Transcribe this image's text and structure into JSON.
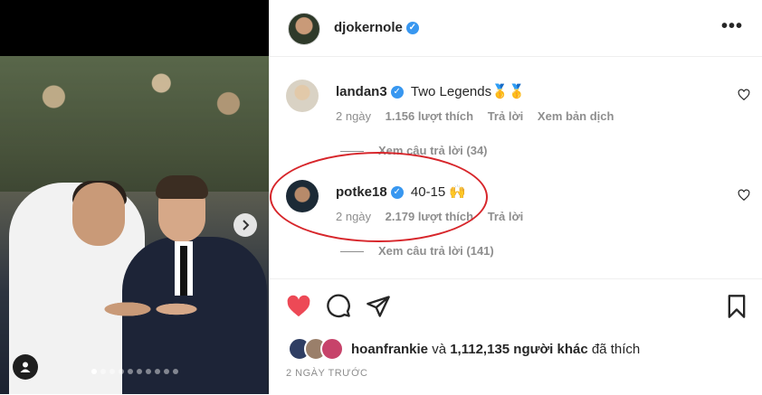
{
  "post": {
    "username": "djokernole",
    "more_label": "•••"
  },
  "carousel": {
    "total_slides": 10,
    "active_slide": 1
  },
  "comments": [
    {
      "username": "landan3",
      "text": "Two Legends🥇🥇",
      "time": "2 ngày",
      "likes": "1.156 lượt thích",
      "reply_label": "Trả lời",
      "translate_label": "Xem bản dịch",
      "replies_label": "Xem câu trả lời (34)"
    },
    {
      "username": "potke18",
      "text": "40-15 🙌",
      "time": "2 ngày",
      "likes": "2.179 lượt thích",
      "reply_label": "Trả lời",
      "replies_label": "Xem câu trả lời (141)"
    }
  ],
  "likes": {
    "first_user": "hoanfrankie",
    "connector": "và",
    "others": "1,112,135 người khác",
    "suffix": "đã thích"
  },
  "posted": "2 NGÀY TRƯỚC",
  "colors": {
    "verified": "#3897f0",
    "like_red": "#ed4956",
    "highlight_oval": "#d7262b"
  }
}
